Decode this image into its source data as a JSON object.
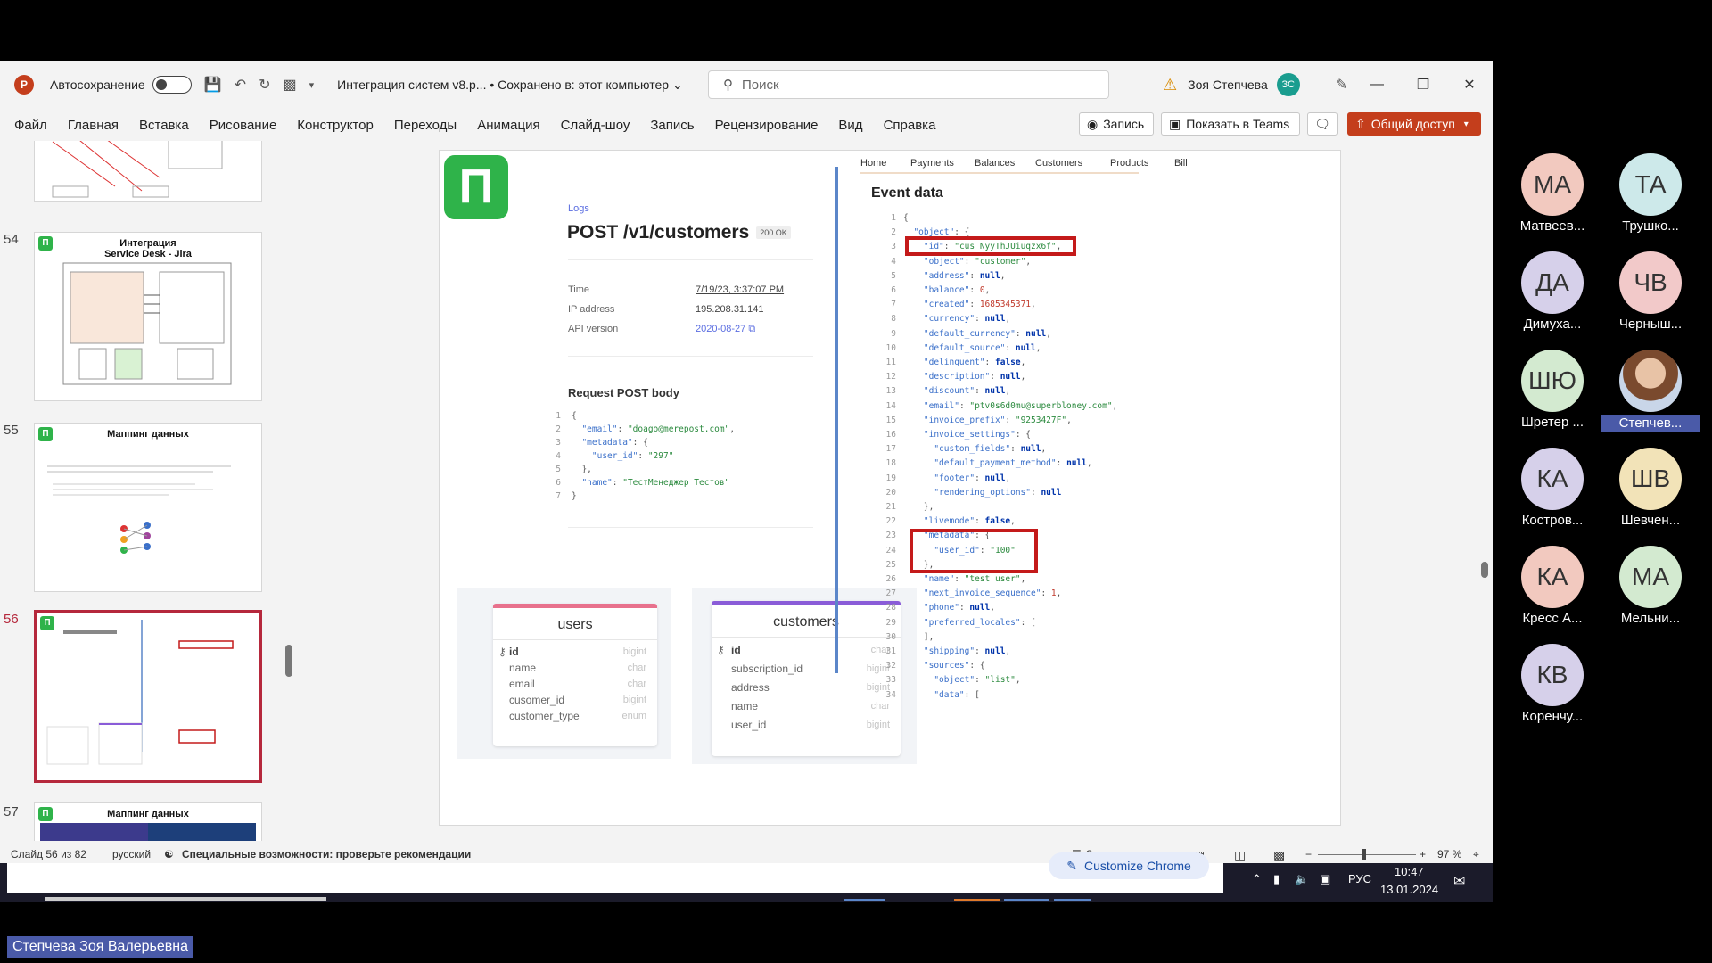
{
  "titlebar": {
    "autosave_label": "Автосохранение",
    "doc_title": "Интеграция систем v8.p... • Сохранено в: этот компьютер ⌄",
    "search_placeholder": "Поиск",
    "user_name": "Зоя Степчева",
    "user_initials": "ЗС"
  },
  "menu": [
    "Файл",
    "Главная",
    "Вставка",
    "Рисование",
    "Конструктор",
    "Переходы",
    "Анимация",
    "Слайд-шоу",
    "Запись",
    "Рецензирование",
    "Вид",
    "Справка"
  ],
  "ribbon_buttons": {
    "record": "Запись",
    "teams": "Показать в Teams",
    "share": "Общий доступ"
  },
  "slides": [
    {
      "num": "54",
      "title": "Интеграция\nService Desk - Jira"
    },
    {
      "num": "55",
      "title": "Маппинг данных"
    },
    {
      "num": "56",
      "title": ""
    },
    {
      "num": "57",
      "title": "Маппинг данных"
    }
  ],
  "slide": {
    "logs_link": "Logs",
    "title": "POST /v1/customers",
    "badge": "200 OK",
    "details": [
      {
        "label": "Time",
        "value": "7/19/23, 3:37:07 PM"
      },
      {
        "label": "IP address",
        "value": "195.208.31.141"
      },
      {
        "label": "API version",
        "value": "2020-08-27 ⧉"
      }
    ],
    "request_title": "Request POST body",
    "request_lines": [
      {
        "n": "1",
        "t": "{"
      },
      {
        "n": "2",
        "t": "  \"email\": \"doago@merepost.com\","
      },
      {
        "n": "3",
        "t": "  \"metadata\": {"
      },
      {
        "n": "4",
        "t": "    \"user_id\": \"297\""
      },
      {
        "n": "5",
        "t": "  },"
      },
      {
        "n": "6",
        "t": "  \"name\": \"ТестМенеджер Тестов\""
      },
      {
        "n": "7",
        "t": "}"
      }
    ],
    "users_table": {
      "title": "users",
      "rows": [
        {
          "name": "id",
          "type": "bigint"
        },
        {
          "name": "name",
          "type": "char"
        },
        {
          "name": "email",
          "type": "char"
        },
        {
          "name": "cusomer_id",
          "type": "bigint"
        },
        {
          "name": "customer_type",
          "type": "enum"
        }
      ]
    },
    "customers_table": {
      "title": "customers",
      "rows": [
        {
          "name": "id",
          "type": "char"
        },
        {
          "name": "subscription_id",
          "type": "bigint"
        },
        {
          "name": "address",
          "type": "bigint"
        },
        {
          "name": "name",
          "type": "char"
        },
        {
          "name": "user_id",
          "type": "bigint"
        }
      ]
    },
    "nav": [
      "Home",
      "Payments",
      "Balances",
      "Customers",
      "Products",
      "Bill"
    ],
    "event_title": "Event data",
    "event_lines": [
      {
        "n": "1",
        "t": "{"
      },
      {
        "n": "2",
        "t": "  \"object\": {"
      },
      {
        "n": "3",
        "t": "    \"id\": \"cus_NyyThJUiuqzx6f\","
      },
      {
        "n": "4",
        "t": "    \"object\": \"customer\","
      },
      {
        "n": "5",
        "t": "    \"address\": null,"
      },
      {
        "n": "6",
        "t": "    \"balance\": 0,"
      },
      {
        "n": "7",
        "t": "    \"created\": 1685345371,"
      },
      {
        "n": "8",
        "t": "    \"currency\": null,"
      },
      {
        "n": "9",
        "t": "    \"default_currency\": null,"
      },
      {
        "n": "10",
        "t": "    \"default_source\": null,"
      },
      {
        "n": "11",
        "t": "    \"delinquent\": false,"
      },
      {
        "n": "12",
        "t": "    \"description\": null,"
      },
      {
        "n": "13",
        "t": "    \"discount\": null,"
      },
      {
        "n": "14",
        "t": "    \"email\": \"ptv0s6d0mu@superbloney.com\","
      },
      {
        "n": "15",
        "t": "    \"invoice_prefix\": \"9253427F\","
      },
      {
        "n": "16",
        "t": "    \"invoice_settings\": {"
      },
      {
        "n": "17",
        "t": "      \"custom_fields\": null,"
      },
      {
        "n": "18",
        "t": "      \"default_payment_method\": null,"
      },
      {
        "n": "19",
        "t": "      \"footer\": null,"
      },
      {
        "n": "20",
        "t": "      \"rendering_options\": null"
      },
      {
        "n": "21",
        "t": "    },"
      },
      {
        "n": "22",
        "t": "    \"livemode\": false,"
      },
      {
        "n": "23",
        "t": "    \"metadata\": {"
      },
      {
        "n": "24",
        "t": "      \"user_id\": \"100\""
      },
      {
        "n": "25",
        "t": "    },"
      },
      {
        "n": "26",
        "t": "    \"name\": \"test user\","
      },
      {
        "n": "27",
        "t": "    \"next_invoice_sequence\": 1,"
      },
      {
        "n": "28",
        "t": "    \"phone\": null,"
      },
      {
        "n": "29",
        "t": "    \"preferred_locales\": ["
      },
      {
        "n": "30",
        "t": "    ],"
      },
      {
        "n": "31",
        "t": "    \"shipping\": null,"
      },
      {
        "n": "32",
        "t": "    \"sources\": {"
      },
      {
        "n": "33",
        "t": "      \"object\": \"list\","
      },
      {
        "n": "34",
        "t": "      \"data\": ["
      }
    ]
  },
  "statusbar": {
    "slide_info": "Слайд 56 из 82",
    "language": "русский",
    "accessibility": "Специальные возможности: проверьте рекомендации",
    "notes": "Заметки",
    "zoom": "97 %"
  },
  "taskbar": {
    "customize_chrome": "Customize Chrome",
    "lang": "РУС",
    "time": "10:47",
    "date": "13.01.2024"
  },
  "participants": [
    {
      "initials": "МА",
      "name": "Матвеев...",
      "color": "#f2c9bf"
    },
    {
      "initials": "ТА",
      "name": "Трушко...",
      "color": "#cde9ea"
    },
    {
      "initials": "ДА",
      "name": "Димуха...",
      "color": "#d6d0ea"
    },
    {
      "initials": "ЧВ",
      "name": "Черныш...",
      "color": "#f2c9c9"
    },
    {
      "initials": "ШЮ",
      "name": "Шретер ...",
      "color": "#d3ead0"
    },
    {
      "initials": "",
      "name": "Степчев...",
      "color": "#c9a98e"
    },
    {
      "initials": "КА",
      "name": "Костров...",
      "color": "#d6d0ea"
    },
    {
      "initials": "ШВ",
      "name": "Шевчен...",
      "color": "#f2e3b8"
    },
    {
      "initials": "КА",
      "name": "Кресс А...",
      "color": "#f2c9bf"
    },
    {
      "initials": "МА",
      "name": "Мельни...",
      "color": "#d3ead0"
    },
    {
      "initials": "КВ",
      "name": "Коренчу...",
      "color": "#d6d0ea"
    }
  ],
  "presenter_name": "Степчева Зоя Валерьевна",
  "colors": {
    "accent_red": "#c41a1a",
    "brand_green": "#2fb34a",
    "ppt_orange": "#c43e1c"
  }
}
